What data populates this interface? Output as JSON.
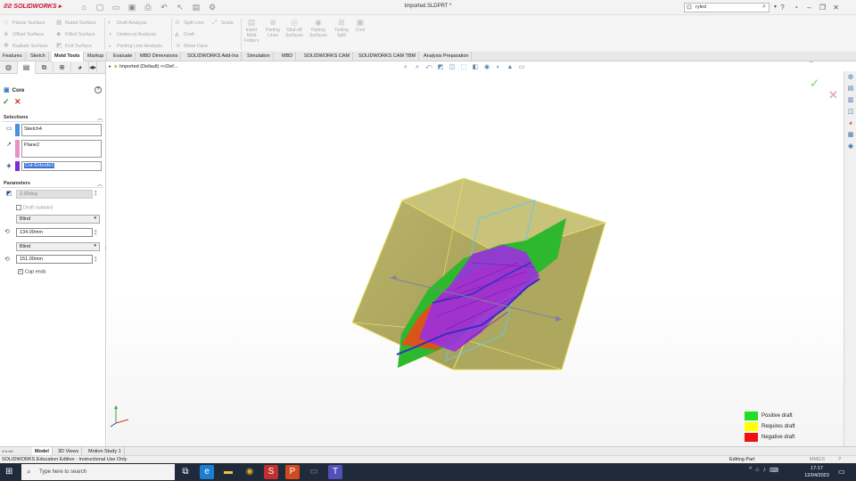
{
  "app": {
    "brand": "SOLIDWORKS",
    "doc_title": "Imported.SLDPRT *",
    "search_value": "ryled"
  },
  "toolbar": {
    "col1": [
      "Planar Surface",
      "Offset Surface",
      "Radiate Surface"
    ],
    "col2": [
      "Ruled Surface",
      "Filled Surface",
      "Knit Surface"
    ],
    "col3": [
      "Draft Analysis",
      "Undercut Analysis",
      "Parting Line Analysis"
    ],
    "col4": [
      "Split Line",
      "Draft",
      "Move Face"
    ],
    "scale": "Scale",
    "big": [
      {
        "line1": "Insert",
        "line2": "Mold",
        "line3": "Folders"
      },
      {
        "line1": "Parting",
        "line2": "Lines",
        "line3": ""
      },
      {
        "line1": "Shut-off",
        "line2": "Surfaces",
        "line3": ""
      },
      {
        "line1": "Parting",
        "line2": "Surfaces",
        "line3": ""
      },
      {
        "line1": "Tooling",
        "line2": "Split",
        "line3": ""
      },
      {
        "line1": "Core",
        "line2": "",
        "line3": ""
      }
    ]
  },
  "tabs": [
    "Features",
    "Sketch",
    "Mold Tools",
    "Markup",
    "Evaluate",
    "MBD Dimensions",
    "SOLIDWORKS Add-Ins",
    "Simulation",
    "MBD",
    "SOLIDWORKS CAM",
    "SOLIDWORKS CAM TBM",
    "Analysis Preparation"
  ],
  "panel": {
    "title": "Core",
    "selections_label": "Selections",
    "sel1": "Sketch4",
    "sel2": "Plane2",
    "sel3": "Cut-Extrude1",
    "parameters_label": "Parameters",
    "draft_angle": "2.00deg",
    "draft_outward": "Draft outward",
    "end1_type": "Blind",
    "depth1": "134.00mm",
    "end2_type": "Blind",
    "depth2": "151.00mm",
    "cap_ends": "Cap ends"
  },
  "viewport": {
    "tree_root": "Imported (Default) <<Def..."
  },
  "legend": [
    {
      "label": "Positive draft",
      "color": "#22dd22"
    },
    {
      "label": "Requires draft",
      "color": "#ffff00"
    },
    {
      "label": "Negative draft",
      "color": "#ee1111"
    }
  ],
  "bottom_tabs": [
    "Model",
    "3D Views",
    "Motion Study 1"
  ],
  "status": {
    "left": "SOLIDWORKS Education Edition - Instructional Use Only",
    "mode": "Editing Part",
    "units": "MMGS"
  },
  "taskbar": {
    "search_placeholder": "Type here to search",
    "time": "17:17",
    "date": "12/04/2023"
  }
}
